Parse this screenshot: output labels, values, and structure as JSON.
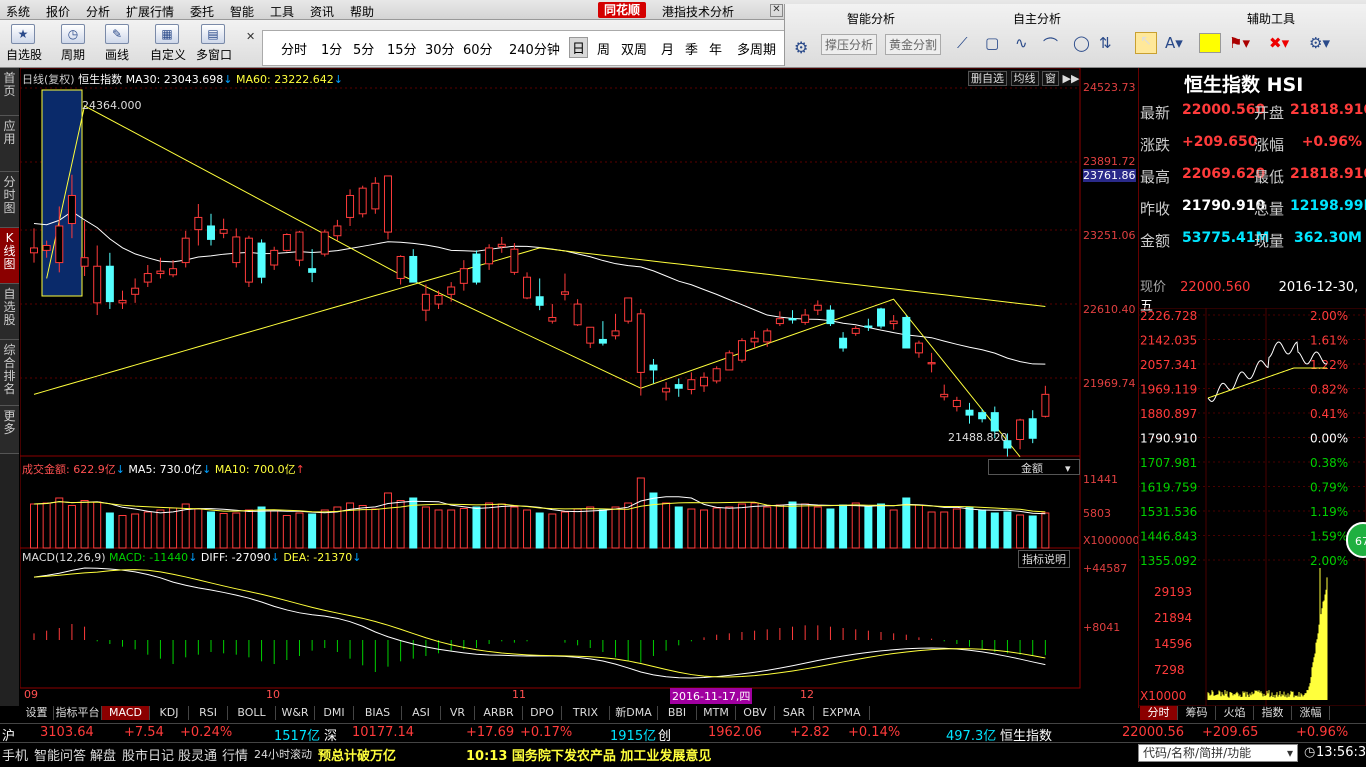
{
  "menu": [
    "系统",
    "报价",
    "分析",
    "扩展行情",
    "委托",
    "智能",
    "工具",
    "资讯",
    "帮助"
  ],
  "app": {
    "logo": "同花顺",
    "title": "港指技术分析"
  },
  "toolbar": {
    "buttons": [
      "自选股",
      "周期",
      "画线",
      "自定义",
      "多窗口"
    ],
    "periods": [
      "分时",
      "1分",
      "5分",
      "15分",
      "30分",
      "60分",
      "240分钟",
      "日",
      "周",
      "双周",
      "月",
      "季",
      "年",
      "多周期"
    ],
    "selected_period": "日",
    "panels": [
      "智能分析",
      "自主分析",
      "辅助工具"
    ],
    "sub_buttons": [
      "撑压分析",
      "黄金分割"
    ]
  },
  "sidebar": [
    "首页",
    "应用",
    "分时图",
    "K线图",
    "自选股",
    "综合排名",
    "更多"
  ],
  "chart": {
    "header": {
      "name": "日线(复权)",
      "index": "恒生指数",
      "ma30": "MA30: 23043.698",
      "ma60": "MA60: 23222.642"
    },
    "right_buttons": [
      "删自选",
      "均线",
      "窗"
    ],
    "y_labels": [
      "24523.73",
      "23891.72",
      "23761.86",
      "23251.06",
      "22610.40",
      "21969.74"
    ],
    "annotations": {
      "high": "24364.000",
      "low": "21488.820"
    },
    "vol_header": {
      "label": "成交金额: 622.9亿",
      "ma5": "MA5: 730.0亿",
      "ma10": "MA10: 700.0亿",
      "dropdown": "金额"
    },
    "vol_y": [
      "11441",
      "5803",
      "X1000000"
    ],
    "macd_header": {
      "label": "MACD(12,26,9)",
      "macd": "MACD: -11440",
      "diff": "DIFF: -27090",
      "dea": "DEA: -21370",
      "btn": "指标说明"
    },
    "macd_y": [
      "+44587",
      "+8041"
    ],
    "x_labels": [
      "09",
      "10",
      "11",
      "2016-11-17,四",
      "12"
    ]
  },
  "indicator_tabs": [
    "设置",
    "指标平台",
    "MACD",
    "KDJ",
    "RSI",
    "BOLL",
    "W&R",
    "DMI",
    "BIAS",
    "ASI",
    "VR",
    "ARBR",
    "DPO",
    "TRIX",
    "新DMA",
    "BBI",
    "MTM",
    "OBV",
    "SAR",
    "EXPMA"
  ],
  "selected_indicator": "MACD",
  "quote": {
    "title": "恒生指数 HSI",
    "rows": [
      [
        "最新",
        "22000.560",
        "开盘",
        "21818.910"
      ],
      [
        "涨跌",
        "+209.650",
        "涨幅",
        "+0.96%"
      ],
      [
        "最高",
        "22069.620",
        "最低",
        "21818.910"
      ],
      [
        "昨收",
        "21790.910",
        "总量",
        "12198.99M"
      ],
      [
        "金额",
        "53775.41M",
        "现量",
        "362.30M"
      ]
    ],
    "current": {
      "label": "现价",
      "price": "22000.560",
      "date": "2016-12-30,五"
    },
    "intraday_left": [
      "2226.728",
      "2142.035",
      "2057.341",
      "1969.119",
      "1880.897",
      "1790.910",
      "1707.981",
      "1619.759",
      "1531.536",
      "1446.843",
      "1355.092"
    ],
    "intraday_right": [
      "2.00%",
      "1.61%",
      "1.22%",
      "0.82%",
      "0.41%",
      "0.00%",
      "0.38%",
      "0.79%",
      "1.19%",
      "1.59%",
      "2.00%"
    ],
    "intraday_vol": [
      "29193",
      "21894",
      "14596",
      "7298",
      "X10000"
    ],
    "badge": "67",
    "tabs": [
      "分时",
      "筹码",
      "火焰",
      "指数",
      "涨幅"
    ]
  },
  "ticker": {
    "sh": "沪",
    "sh_val": "3103.64",
    "sh_chg": "+7.54",
    "sh_pct": "+0.24%",
    "sh_amt": "1517亿",
    "sz": "深",
    "sz_val": "10177.14",
    "sz_chg": "+17.69",
    "sz_pct": "+0.17%",
    "cy_amt": "1915亿",
    "cy": "创",
    "cy_val": "1962.06",
    "cy_chg": "+2.82",
    "cy_pct": "+0.14%",
    "hk_amt": "497.3亿",
    "hk": "恒生指数",
    "hk_val": "22000.56",
    "hk_chg": "+209.65",
    "hk_pct": "+0.96%"
  },
  "status": {
    "items": [
      "手机",
      "智能问答",
      "解盘",
      "股市日记",
      "股灵通",
      "行情",
      "24小时滚动"
    ],
    "news1": "预总计破万亿",
    "news2": "10:13 国务院下发农产品 加工业发展意见",
    "search": "代码/名称/简拼/功能",
    "time": "13:56:38"
  },
  "candles": [
    [
      23160,
      23360,
      23080,
      23200
    ],
    [
      23180,
      23260,
      23120,
      23220
    ],
    [
      23080,
      23540,
      23000,
      23380
    ],
    [
      23400,
      23800,
      23280,
      23630
    ],
    [
      23050,
      23420,
      22970,
      23120
    ],
    [
      22750,
      23220,
      22650,
      23050
    ],
    [
      23050,
      23160,
      22700,
      22760
    ],
    [
      22750,
      22850,
      22700,
      22770
    ],
    [
      22820,
      22950,
      22750,
      22870
    ],
    [
      22920,
      23060,
      22880,
      22990
    ],
    [
      22990,
      23120,
      22950,
      23010
    ],
    [
      22980,
      23100,
      22960,
      23030
    ],
    [
      23080,
      23340,
      23040,
      23280
    ],
    [
      23350,
      23560,
      23220,
      23450
    ],
    [
      23380,
      23480,
      23220,
      23270
    ],
    [
      23320,
      23440,
      23280,
      23350
    ],
    [
      23080,
      23360,
      23040,
      23290
    ],
    [
      22920,
      23300,
      22880,
      23280
    ],
    [
      23240,
      23270,
      22910,
      22960
    ],
    [
      23060,
      23210,
      23020,
      23180
    ],
    [
      23180,
      23320,
      23170,
      23310
    ],
    [
      23100,
      23340,
      23050,
      23330
    ],
    [
      23030,
      23190,
      22920,
      23000
    ],
    [
      23150,
      23350,
      23130,
      23330
    ],
    [
      23300,
      23430,
      23260,
      23380
    ],
    [
      23450,
      23680,
      23380,
      23630
    ],
    [
      23480,
      23710,
      23450,
      23690
    ],
    [
      23520,
      23780,
      23480,
      23730
    ],
    [
      23330,
      23770,
      23270,
      23790
    ],
    [
      22950,
      23140,
      22900,
      23130
    ],
    [
      23130,
      23190,
      22920,
      22920
    ],
    [
      22690,
      22900,
      22600,
      22820
    ],
    [
      22740,
      22850,
      22700,
      22810
    ],
    [
      22820,
      22920,
      22760,
      22880
    ],
    [
      22910,
      23100,
      22850,
      23030
    ],
    [
      23150,
      23180,
      22900,
      22920
    ],
    [
      23070,
      23230,
      23020,
      23200
    ],
    [
      23210,
      23290,
      23160,
      23230
    ],
    [
      23000,
      23240,
      22980,
      23190
    ],
    [
      22790,
      23000,
      22780,
      22960
    ],
    [
      22800,
      22950,
      22690,
      22730
    ],
    [
      22600,
      22740,
      22580,
      22630
    ],
    [
      22820,
      22990,
      22770,
      22840
    ],
    [
      22570,
      22780,
      22560,
      22740
    ],
    [
      22420,
      22550,
      22380,
      22550
    ],
    [
      22450,
      22600,
      22400,
      22420
    ],
    [
      22480,
      22660,
      22450,
      22520
    ],
    [
      22600,
      22790,
      22580,
      22790
    ],
    [
      22180,
      22700,
      21990,
      22660
    ],
    [
      22240,
      22290,
      22090,
      22200
    ],
    [
      22020,
      22100,
      21950,
      22050
    ],
    [
      22080,
      22130,
      21980,
      22050
    ],
    [
      22040,
      22180,
      22000,
      22120
    ],
    [
      22070,
      22180,
      22020,
      22140
    ],
    [
      22110,
      22230,
      22090,
      22210
    ],
    [
      22200,
      22360,
      22200,
      22340
    ],
    [
      22280,
      22460,
      22260,
      22440
    ],
    [
      22430,
      22520,
      22380,
      22460
    ],
    [
      22430,
      22540,
      22390,
      22520
    ],
    [
      22580,
      22680,
      22560,
      22620
    ],
    [
      22620,
      22690,
      22580,
      22610
    ],
    [
      22590,
      22700,
      22570,
      22650
    ],
    [
      22690,
      22770,
      22650,
      22730
    ],
    [
      22690,
      22730,
      22560,
      22580
    ],
    [
      22460,
      22510,
      22350,
      22380
    ],
    [
      22500,
      22560,
      22480,
      22540
    ],
    [
      22560,
      22620,
      22520,
      22550
    ],
    [
      22700,
      22710,
      22540,
      22560
    ],
    [
      22580,
      22650,
      22530,
      22600
    ],
    [
      22630,
      22650,
      22400,
      22380
    ],
    [
      22340,
      22440,
      22300,
      22420
    ],
    [
      22250,
      22340,
      22180,
      22260
    ],
    [
      21980,
      22080,
      21950,
      22000
    ],
    [
      21900,
      21980,
      21860,
      21950
    ],
    [
      21870,
      21930,
      21760,
      21830
    ],
    [
      21850,
      21880,
      21770,
      21800
    ],
    [
      21850,
      21900,
      21640,
      21700
    ],
    [
      21620,
      21680,
      21490,
      21560
    ],
    [
      21630,
      21800,
      21550,
      21790
    ],
    [
      21800,
      21870,
      21600,
      21640
    ],
    [
      21820,
      22070,
      21810,
      22000
    ]
  ],
  "vols": [
    880,
    900,
    1000,
    850,
    950,
    920,
    700,
    650,
    680,
    720,
    760,
    800,
    880,
    780,
    720,
    690,
    700,
    760,
    820,
    740,
    650,
    700,
    680,
    760,
    820,
    900,
    850,
    780,
    1100,
    950,
    1000,
    820,
    760,
    760,
    790,
    820,
    900,
    880,
    820,
    760,
    700,
    680,
    720,
    780,
    820,
    760,
    820,
    900,
    1400,
    1100,
    900,
    820,
    780,
    760,
    800,
    820,
    880,
    900,
    820,
    860,
    920,
    880,
    820,
    780,
    860,
    900,
    820,
    880,
    760,
    1000,
    860,
    720,
    720,
    780,
    820,
    760,
    700,
    720,
    660,
    640,
    700
  ],
  "macd_bars": [
    500,
    700,
    900,
    1200,
    1000,
    -100,
    -300,
    -500,
    -700,
    -1100,
    -1400,
    -1800,
    -1300,
    -1100,
    -900,
    -1000,
    -1100,
    -1300,
    -1600,
    -1800,
    -1500,
    -1200,
    -800,
    -600,
    -900,
    -1400,
    -1900,
    -2400,
    -2000,
    -1600,
    -1400,
    -1200,
    -1000,
    -800,
    -700,
    -600,
    -300,
    -100,
    -200,
    -100,
    0,
    0,
    -200,
    -400,
    -600,
    -900,
    -1300,
    -1600,
    -1700,
    -1200,
    -800,
    -400,
    -100,
    200,
    400,
    500,
    600,
    700,
    800,
    900,
    1000,
    1100,
    1100,
    1000,
    900,
    800,
    700,
    600,
    500,
    400,
    200,
    100,
    -100,
    -300,
    -500,
    -700,
    -900,
    -1000,
    -1100,
    -1200,
    -1140
  ]
}
